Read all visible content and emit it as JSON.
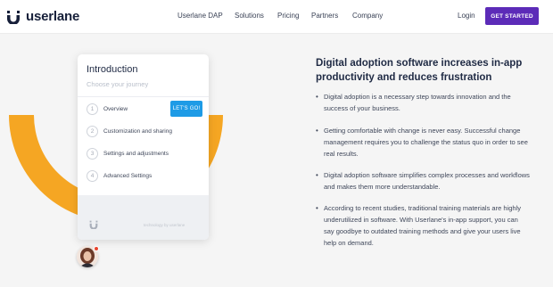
{
  "header": {
    "brand": "userlane",
    "nav": [
      "Userlane DAP",
      "Solutions",
      "Pricing",
      "Partners",
      "Company"
    ],
    "login": "Login",
    "cta": "GET STARTED"
  },
  "card": {
    "title": "Introduction",
    "subtitle": "Choose your journey",
    "go_button": "LET'S GO!",
    "steps": [
      {
        "num": "1",
        "label": "Overview"
      },
      {
        "num": "2",
        "label": "Customization and sharing"
      },
      {
        "num": "3",
        "label": "Settings and adjustments"
      },
      {
        "num": "4",
        "label": "Advanced Settings"
      }
    ],
    "footer_text": "technology by userlane"
  },
  "content": {
    "headline": "Digital adoption software increases in-app productivity and reduces frustration",
    "bullets": [
      "Digital adoption is a necessary step towards innovation and the success of your business.",
      "Getting comfortable with change is never easy. Successful change management requires you to challenge the status quo in order to see real results.",
      "Digital adoption software simplifies complex processes and workflows and makes them more understandable.",
      "According to recent studies, traditional training materials are highly underutilized in software. With Userlane's in-app support, you can say goodbye to outdated training methods and give your users live help on demand."
    ]
  },
  "colors": {
    "brand_purple": "#5c2bb8",
    "accent_yellow": "#f5a623",
    "button_blue": "#1e9be6"
  },
  "icons": [
    "userlane-logo-icon",
    "userlane-u-icon",
    "notification-dot-icon"
  ]
}
